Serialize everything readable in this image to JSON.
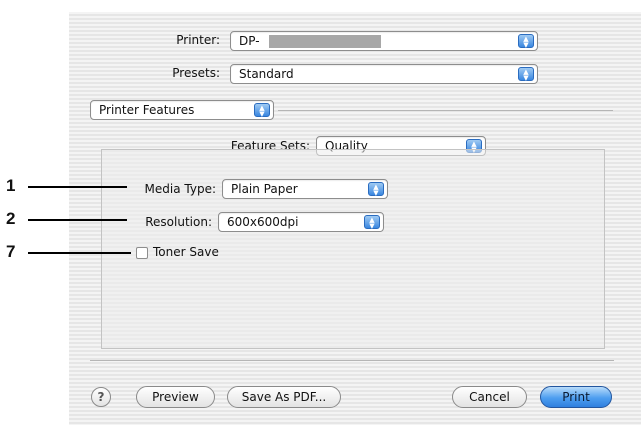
{
  "printer": {
    "label": "Printer:",
    "value": "DP-"
  },
  "presets": {
    "label": "Presets:",
    "value": "Standard"
  },
  "panel": {
    "value": "Printer Features"
  },
  "feature_sets": {
    "label": "Feature Sets:",
    "value": "Quality"
  },
  "media_type": {
    "label": "Media Type:",
    "value": "Plain Paper"
  },
  "resolution": {
    "label": "Resolution:",
    "value": "600x600dpi"
  },
  "toner_save": {
    "label": "Toner Save",
    "checked": false
  },
  "callouts": [
    "1",
    "2",
    "7"
  ],
  "buttons": {
    "help": "?",
    "preview": "Preview",
    "save_as_pdf": "Save As PDF...",
    "cancel": "Cancel",
    "print": "Print"
  },
  "colors": {
    "accent": "#3a87e0",
    "redacted": "#a7a7a7"
  }
}
